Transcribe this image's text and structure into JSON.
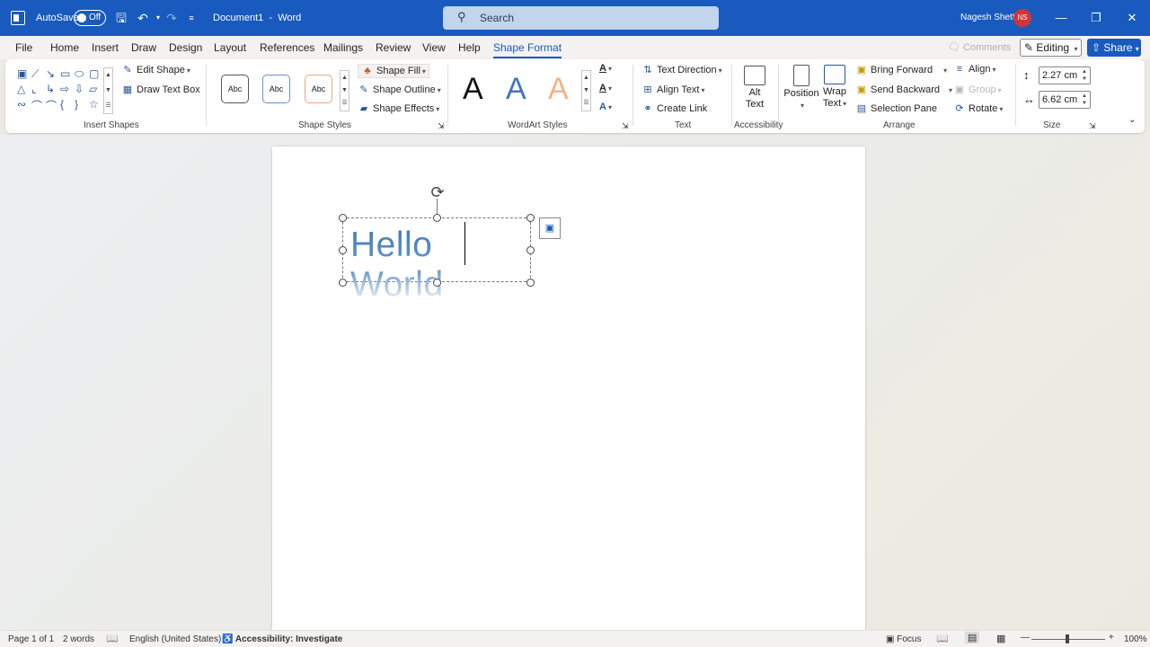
{
  "titlebar": {
    "autosave_label": "AutoSave",
    "autosave_state": "Off",
    "document_name": "Document1",
    "separator": "-",
    "app_name": "Word",
    "search_placeholder": "Search",
    "user_name": "Nagesh Shetti",
    "user_initials": "NS",
    "accent_color": "#185abd",
    "avatar_color": "#d13438"
  },
  "menu": {
    "tabs": [
      "File",
      "Home",
      "Insert",
      "Draw",
      "Design",
      "Layout",
      "References",
      "Mailings",
      "Review",
      "View",
      "Help",
      "Shape Format"
    ],
    "active_tab": "Shape Format",
    "comments_label": "Comments",
    "editing_label": "Editing",
    "share_label": "Share"
  },
  "ribbon": {
    "insert_shapes": {
      "edit_shape": "Edit Shape",
      "draw_text_box": "Draw Text Box",
      "group_label": "Insert Shapes"
    },
    "shape_styles": {
      "style_samples": [
        "Abc",
        "Abc",
        "Abc"
      ],
      "shape_fill": "Shape Fill",
      "shape_outline": "Shape Outline",
      "shape_effects": "Shape Effects",
      "group_label": "Shape Styles"
    },
    "wordart_styles": {
      "samples": [
        "A",
        "A",
        "A"
      ],
      "group_label": "WordArt Styles"
    },
    "text": {
      "text_direction": "Text Direction",
      "align_text": "Align Text",
      "create_link": "Create Link",
      "group_label": "Text"
    },
    "accessibility": {
      "alt_text_line1": "Alt",
      "alt_text_line2": "Text",
      "group_label": "Accessibility"
    },
    "arrange": {
      "position": "Position",
      "wrap_text_line1": "Wrap",
      "wrap_text_line2": "Text",
      "bring_forward": "Bring Forward",
      "send_backward": "Send Backward",
      "selection_pane": "Selection Pane",
      "align": "Align",
      "group": "Group",
      "rotate": "Rotate",
      "group_label": "Arrange"
    },
    "size": {
      "height": "2.27 cm",
      "width": "6.62 cm",
      "group_label": "Size"
    }
  },
  "document": {
    "wordart_text": "Hello World"
  },
  "status": {
    "page": "Page 1 of 1",
    "words": "2 words",
    "language": "English (United States)",
    "accessibility": "Accessibility: Investigate",
    "focus": "Focus",
    "zoom": "100%"
  }
}
